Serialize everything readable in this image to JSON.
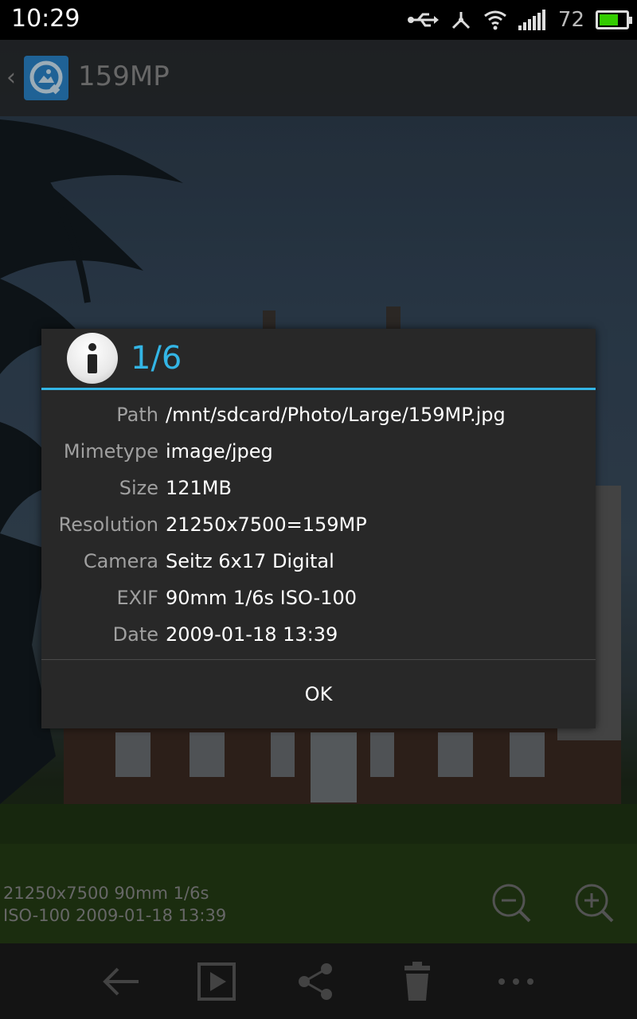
{
  "status_bar": {
    "time": "10:29",
    "battery_percent": "72",
    "battery_level": 0.72,
    "icons": [
      "usb-icon",
      "usb-debug-icon",
      "wifi-icon",
      "signal-icon",
      "battery-icon"
    ]
  },
  "action_bar": {
    "title": "159MP",
    "app_icon": "gallery-app-icon"
  },
  "overlay": {
    "line1": "21250x7500 90mm 1/6s",
    "line2": "ISO-100  2009-01-18 13:39"
  },
  "dialog": {
    "title": "1/6",
    "rows": [
      {
        "label": "Path",
        "value": "/mnt/sdcard/Photo/Large/159MP.jpg"
      },
      {
        "label": "Mimetype",
        "value": "image/jpeg"
      },
      {
        "label": "Size",
        "value": "121MB"
      },
      {
        "label": "Resolution",
        "value": "21250x7500=159MP"
      },
      {
        "label": "Camera",
        "value": "Seitz 6x17 Digital"
      },
      {
        "label": "EXIF",
        "value": "90mm 1/6s ISO-100"
      },
      {
        "label": "Date",
        "value": "2009-01-18 13:39"
      }
    ],
    "ok_label": "OK"
  },
  "bottom_bar": {
    "buttons": [
      "back-arrow-icon",
      "slideshow-icon",
      "share-icon",
      "delete-icon",
      "more-icon"
    ]
  },
  "colors": {
    "accent": "#33b5e5",
    "dialog_bg": "#282828",
    "battery": "#33cc00"
  }
}
